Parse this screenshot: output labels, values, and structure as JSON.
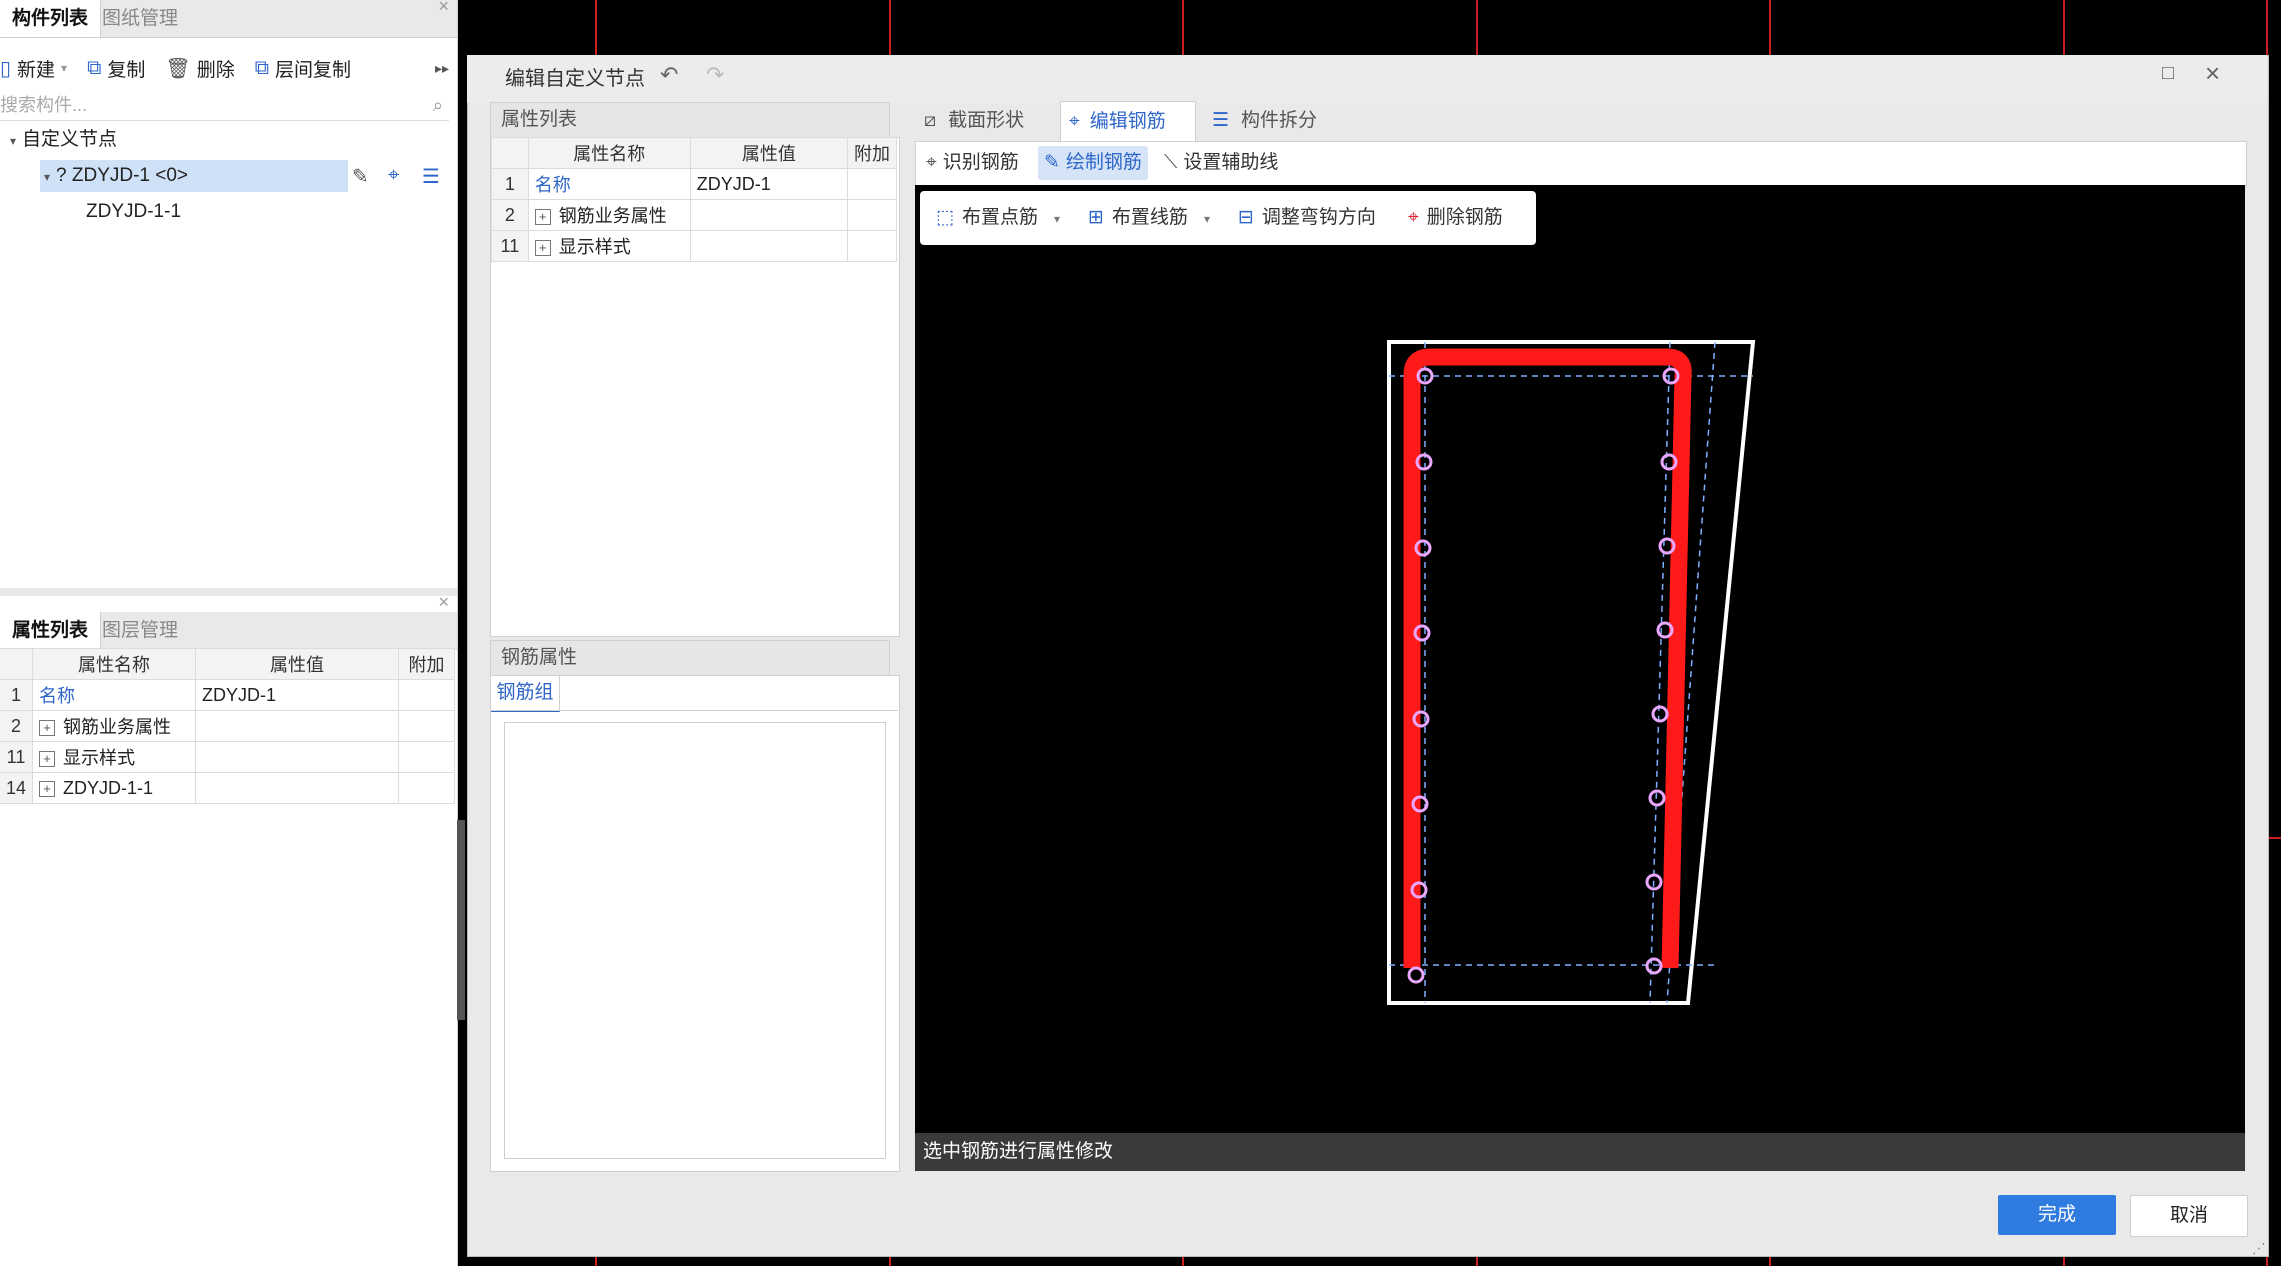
{
  "left_panel": {
    "top_tabs": [
      "构件列表",
      "图纸管理"
    ],
    "toolbar": {
      "new": "新建",
      "copy": "复制",
      "delete": "删除",
      "floor_copy": "层间复制"
    },
    "search_placeholder": "搜索构件...",
    "tree": {
      "root": "自定义节点",
      "node": "? ZDYJD-1 <0>",
      "child": "ZDYJD-1-1"
    },
    "bottom_tabs": [
      "属性列表",
      "图层管理"
    ],
    "prop_table": {
      "headers": [
        "属性名称",
        "属性值",
        "附加"
      ],
      "rows": [
        {
          "idx": "1",
          "name": "名称",
          "value": "ZDYJD-1"
        },
        {
          "idx": "2",
          "name": "钢筋业务属性",
          "value": ""
        },
        {
          "idx": "11",
          "name": "显示样式",
          "value": ""
        },
        {
          "idx": "14",
          "name": "ZDYJD-1-1",
          "value": ""
        }
      ]
    }
  },
  "dialog": {
    "title": "编辑自定义节点",
    "prop_list_title": "属性列表",
    "prop_table": {
      "headers": [
        "属性名称",
        "属性值",
        "附加"
      ],
      "rows": [
        {
          "idx": "1",
          "name": "名称",
          "value": "ZDYJD-1"
        },
        {
          "idx": "2",
          "name": "钢筋业务属性",
          "value": ""
        },
        {
          "idx": "11",
          "name": "显示样式",
          "value": ""
        }
      ]
    },
    "rebar_props_title": "钢筋属性",
    "rebar_group_tab": "钢筋组",
    "canvas_tabs": [
      "截面形状",
      "编辑钢筋",
      "构件拆分"
    ],
    "sub_tools": [
      "识别钢筋",
      "绘制钢筋",
      "设置辅助线"
    ],
    "draw_tools": [
      "布置点筋",
      "布置线筋",
      "调整弯钩方向",
      "删除钢筋"
    ],
    "status": "选中钢筋进行属性修改",
    "ok": "完成",
    "cancel": "取消",
    "colors": {
      "accent": "#2f66c9",
      "rebar": "#ff1a1a",
      "point": "#e9a7ff",
      "outline": "#ffffff",
      "grid": "#ff2a2a"
    }
  }
}
